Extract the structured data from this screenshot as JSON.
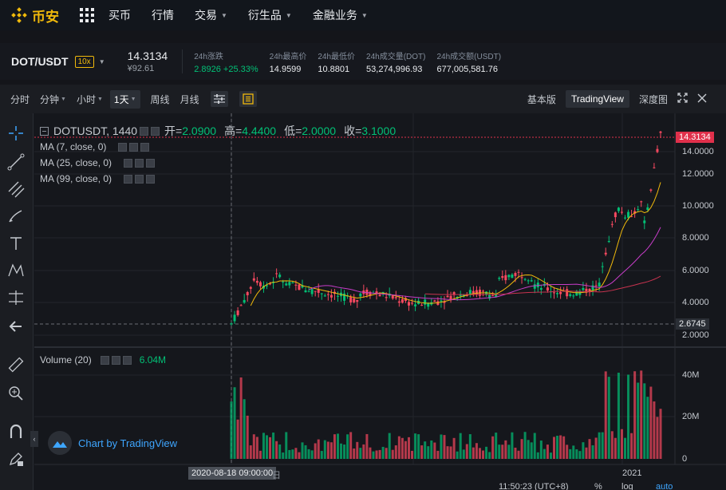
{
  "nav": {
    "logo_text": "币安",
    "items": [
      {
        "label": "买币",
        "caret": false
      },
      {
        "label": "行情",
        "caret": false
      },
      {
        "label": "交易",
        "caret": true
      },
      {
        "label": "衍生品",
        "caret": true
      },
      {
        "label": "金融业务",
        "caret": true
      }
    ]
  },
  "ticker": {
    "pair": "DOT/USDT",
    "leverage": "10x",
    "last_price": "14.3134",
    "last_price_cny": "¥92.61",
    "stats": [
      {
        "label": "24h涨跌",
        "value": "2.8926 +25.33%",
        "up": true
      },
      {
        "label": "24h最高价",
        "value": "14.9599"
      },
      {
        "label": "24h最低价",
        "value": "10.8801"
      },
      {
        "label": "24h成交量(DOT)",
        "value": "53,274,996.93"
      },
      {
        "label": "24h成交额(USDT)",
        "value": "677,005,581.76"
      }
    ]
  },
  "toolbar": {
    "timeframes": [
      "分时",
      "分钟",
      "小时",
      "1天",
      "周线",
      "月线"
    ],
    "selected_tf": "1天",
    "views": [
      "基本版",
      "TradingView",
      "深度图"
    ],
    "selected_view": "TradingView"
  },
  "legend": {
    "symbol": "DOTUSDT, 1440",
    "open_label": "开=",
    "open": "2.0900",
    "high_label": "高=",
    "high": "4.4400",
    "low_label": "低=",
    "low": "2.0000",
    "close_label": "收=",
    "close": "3.1000",
    "ma": [
      "MA (7, close, 0)",
      "MA (25, close, 0)",
      "MA (99, close, 0)"
    ],
    "volume": "Volume (20)",
    "volume_value": "6.04M"
  },
  "axis": {
    "price_ticks": [
      "14.0000",
      "12.0000",
      "10.0000",
      "8.0000",
      "6.0000",
      "4.0000",
      "2.0000"
    ],
    "current_price_tag": "14.3134",
    "crosshair_price_tag": "2.6745",
    "volume_ticks": [
      "40M",
      "20M",
      "0"
    ],
    "date_tag": "2020-08-18 09:00:00",
    "year_label": "2021",
    "time_label": "11:50:23 (UTC+8)",
    "pct": "%",
    "log": "log",
    "auto": "auto",
    "date_fragment": "日"
  },
  "brand": "Chart by TradingView",
  "colors": {
    "up": "#02c076",
    "down": "#f84960",
    "ma7": "#f0b90b",
    "ma25": "#c73dc8",
    "ma99": "#c8334f",
    "accent": "#f0b90b"
  }
}
